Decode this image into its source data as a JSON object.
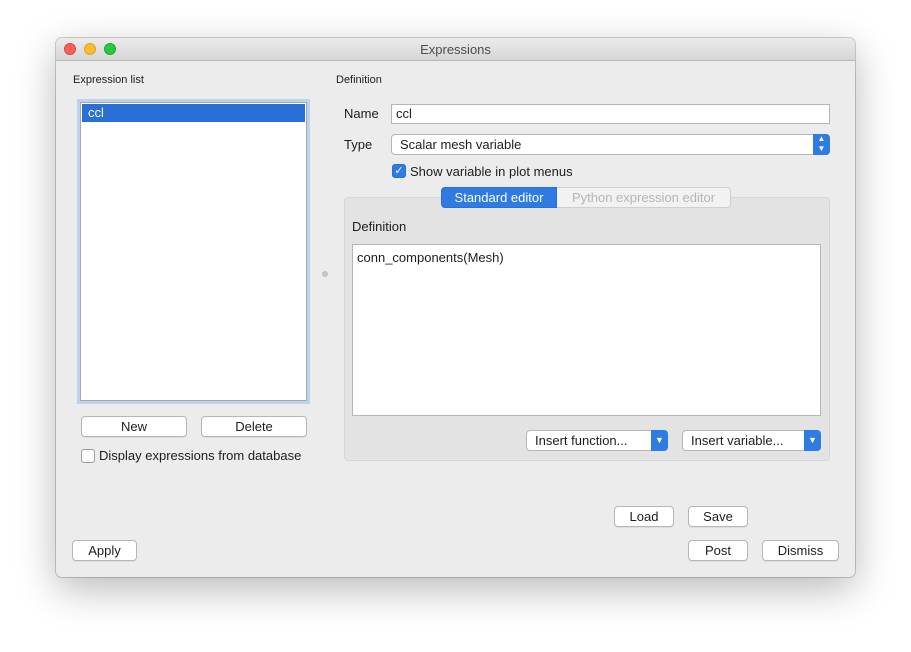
{
  "window": {
    "title": "Expressions"
  },
  "expression_list": {
    "heading": "Expression list",
    "items": [
      {
        "label": "ccl",
        "selected": true
      }
    ],
    "new_button": "New",
    "delete_button": "Delete",
    "display_db_label": "Display expressions from database",
    "display_db_checked": false
  },
  "definition": {
    "heading": "Definition",
    "name_label": "Name",
    "name_value": "ccl",
    "type_label": "Type",
    "type_value": "Scalar mesh variable",
    "show_in_menus_label": "Show variable in plot menus",
    "show_in_menus_checked": true,
    "tabs": [
      {
        "label": "Standard editor",
        "active": true
      },
      {
        "label": "Python expression editor",
        "active": false
      }
    ],
    "editor_heading": "Definition",
    "editor_text": "conn_components(Mesh)",
    "insert_function": "Insert function...",
    "insert_variable": "Insert variable..."
  },
  "footer": {
    "load": "Load",
    "save": "Save",
    "apply": "Apply",
    "post": "Post",
    "dismiss": "Dismiss"
  },
  "colors": {
    "accent": "#2f7be4",
    "selection": "#2a6fd6",
    "window_bg": "#ececec"
  }
}
